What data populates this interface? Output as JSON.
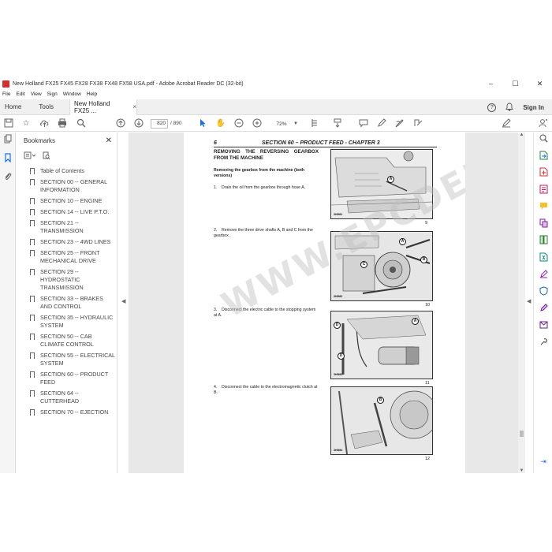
{
  "window": {
    "title": "New Holland FX25 FX45 FX28 FX38 FX48 FX58 USA.pdf - Adobe Acrobat Reader DC (32-bit)",
    "minimize": "–",
    "maximize": "☐",
    "close": "✕"
  },
  "menu": [
    "File",
    "Edit",
    "View",
    "Sign",
    "Window",
    "Help"
  ],
  "tabs": {
    "home": "Home",
    "tools": "Tools",
    "document": "New Holland FX25 ...",
    "close": "×",
    "help_icon": "?",
    "bell_icon": "🔔",
    "signin": "Sign In"
  },
  "toolbar": {
    "page_current": "820",
    "page_total": "/  890",
    "zoom": "72%",
    "zoom_dropdown": "▼"
  },
  "bookmarks": {
    "title": "Bookmarks",
    "close": "✕",
    "items": [
      "Table of Contents",
      "SECTION 00 -- GENERAL INFORMATION",
      "SECTION 10 -- ENGINE",
      "SECTION 14 -- LIVE P.T.O.",
      "SECTION 21 -- TRANSMISSION",
      "SECTION 23 -- 4WD LINES",
      "SECTION 25 -- FRONT MECHANICAL DRIVE",
      "SECTION 29 -- HYDROSTATIC TRANSMISSION",
      "SECTION 33 -- BRAKES AND CONTROL",
      "SECTION 35 -- HYDRAULIC SYSTEM",
      "SECTION 50 -- CAB CLIMATE CONTROL",
      "SECTION 55 -- ELECTRICAL SYSTEM",
      "SECTION 60 -- PRODUCT FEED",
      "SECTION 64 -- CUTTERHEAD",
      "SECTION 70 -- EJECTION"
    ]
  },
  "document": {
    "page_number": "6",
    "header": "SECTION 60 – PRODUCT FEED - CHAPTER 3",
    "section_title": "REMOVING THE REVERSING GEARBOX FROM THE MACHINE",
    "subtitle": "Removing the gearbox from the machine (both versions)",
    "steps": [
      {
        "n": "1.",
        "text": "Drain the oil from the gearbox through hose A."
      },
      {
        "n": "2.",
        "text": "Remove the three drive shafts A, B and C from the gearbox ."
      },
      {
        "n": "3.",
        "text": "Disconnect the electric cable to the stopping system at A."
      },
      {
        "n": "4.",
        "text": "Disconnect the cable to the electromagnetic clutch at B."
      }
    ],
    "figures": [
      {
        "num": "9",
        "code": "3H9M1",
        "callouts": [
          "A"
        ]
      },
      {
        "num": "10",
        "code": "3H9M2",
        "callouts": [
          "A",
          "B",
          "C"
        ]
      },
      {
        "num": "11",
        "code": "3H9M3",
        "callouts": [
          "D",
          "A",
          "D"
        ]
      },
      {
        "num": "12",
        "code": "3H9M4",
        "callouts": [
          "B"
        ]
      }
    ],
    "watermark": "WWW.EPCDEPO.COM"
  },
  "colors": {
    "accent": "#1473e6",
    "pdf_red": "#d32f2f",
    "page_bg": "#e8e8e8"
  },
  "icons": {
    "left_rail": [
      "page-thumbnails-icon",
      "bookmarks-icon",
      "attachments-icon"
    ],
    "right_rail": [
      "search-zoom-icon",
      "export-pdf-icon",
      "create-pdf-icon",
      "edit-pdf-icon",
      "comment-icon",
      "combine-files-icon",
      "organize-pages-icon",
      "compress-pdf-icon",
      "fill-sign-icon",
      "protect-icon",
      "sign-icon",
      "send-icon",
      "more-tools-icon",
      "expand-icon"
    ]
  }
}
